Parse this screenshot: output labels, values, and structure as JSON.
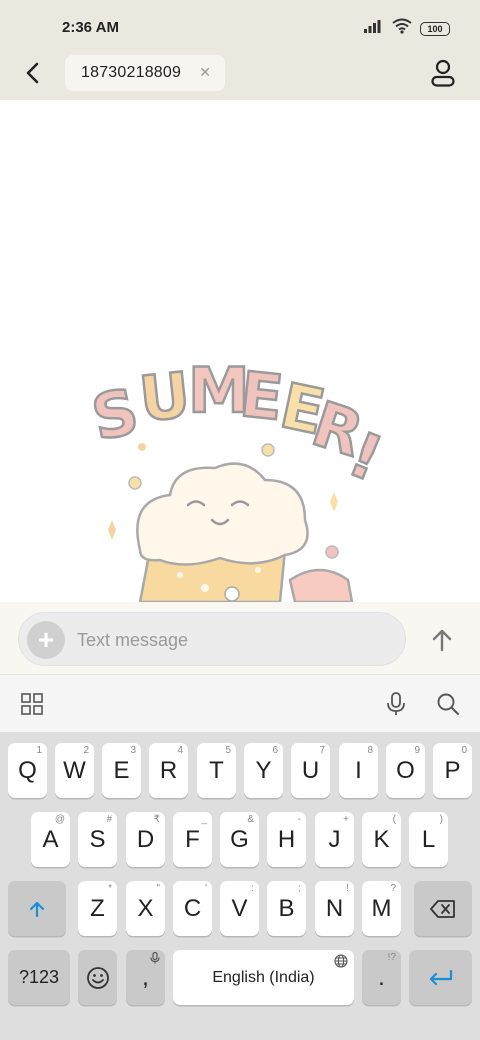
{
  "status_bar": {
    "time": "2:36 AM",
    "battery_level": "100",
    "icons": [
      "signal-icon",
      "wifi-icon",
      "battery-icon"
    ]
  },
  "header": {
    "back_icon": "back-arrow-icon",
    "recipient_number": "18730218809",
    "chip_close_icon": "close-icon",
    "contact_icon": "contact-person-icon"
  },
  "wallpaper": {
    "text": "SUMEER!"
  },
  "compose": {
    "placeholder": "Text message",
    "add_icon": "plus-icon",
    "send_icon": "send-arrow-icon"
  },
  "keyboard_toolbar": {
    "icons": [
      "apps-grid-icon",
      "microphone-icon",
      "search-icon"
    ]
  },
  "keyboard": {
    "row1": [
      {
        "label": "Q",
        "hint": "1"
      },
      {
        "label": "W",
        "hint": "2"
      },
      {
        "label": "E",
        "hint": "3"
      },
      {
        "label": "R",
        "hint": "4"
      },
      {
        "label": "T",
        "hint": "5"
      },
      {
        "label": "Y",
        "hint": "6"
      },
      {
        "label": "U",
        "hint": "7"
      },
      {
        "label": "I",
        "hint": "8"
      },
      {
        "label": "O",
        "hint": "9"
      },
      {
        "label": "P",
        "hint": "0"
      }
    ],
    "row2": [
      {
        "label": "A",
        "hint": "@"
      },
      {
        "label": "S",
        "hint": "#"
      },
      {
        "label": "D",
        "hint": "₹"
      },
      {
        "label": "F",
        "hint": "_"
      },
      {
        "label": "G",
        "hint": "&"
      },
      {
        "label": "H",
        "hint": "-"
      },
      {
        "label": "J",
        "hint": "+"
      },
      {
        "label": "K",
        "hint": "("
      },
      {
        "label": "L",
        "hint": ")"
      }
    ],
    "row3": [
      {
        "label": "Z",
        "hint": "*"
      },
      {
        "label": "X",
        "hint": "\""
      },
      {
        "label": "C",
        "hint": "'"
      },
      {
        "label": "V",
        "hint": ":"
      },
      {
        "label": "B",
        "hint": ";"
      },
      {
        "label": "N",
        "hint": "!"
      },
      {
        "label": "M",
        "hint": "?"
      }
    ],
    "shift_icon": "shift-icon",
    "backspace_icon": "backspace-icon",
    "symbols_label": "?123",
    "emoji_icon": "emoji-icon",
    "comma_label": ",",
    "space_label": "English (India)",
    "period_label": ".",
    "period_hint": "!?",
    "enter_icon": "enter-icon",
    "accent_color": "#1a8fd6"
  }
}
